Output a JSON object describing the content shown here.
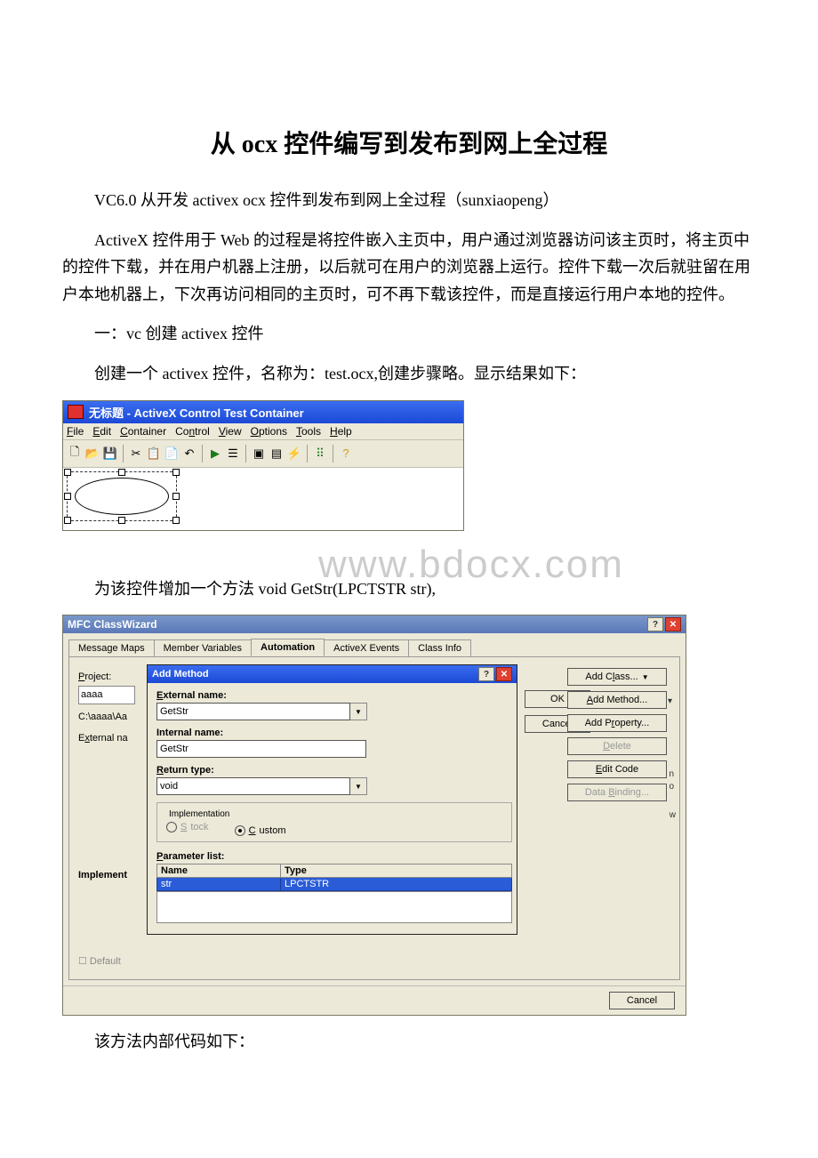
{
  "title": "从 ocx 控件编写到发布到网上全过程",
  "para1": "VC6.0 从开发 activex ocx 控件到发布到网上全过程（sunxiaopeng）",
  "para2": "ActiveX 控件用于 Web 的过程是将控件嵌入主页中，用户通过浏览器访问该主页时，将主页中的控件下载，并在用户机器上注册，以后就可在用户的浏览器上运行。控件下载一次后就驻留在用户本地机器上，下次再访问相同的主页时，可不再下载该控件，而是直接运行用户本地的控件。",
  "para3": "一：vc 创建 activex 控件",
  "para4": "创建一个 activex 控件，名称为：test.ocx,创建步骤略。显示结果如下：",
  "para5": "为该控件增加一个方法 void GetStr(LPCTSTR str),",
  "para6": "该方法内部代码如下：",
  "watermark": "www.bdocx.com",
  "shot1": {
    "title": "无标题 - ActiveX Control Test Container",
    "menu": {
      "file": "File",
      "edit": "Edit",
      "container": "Container",
      "control": "Control",
      "view": "View",
      "options": "Options",
      "tools": "Tools",
      "help": "Help"
    },
    "icons": {
      "new": "new-icon",
      "open": "open-icon",
      "save": "save-icon",
      "cut": "cut-icon",
      "copy": "copy-icon",
      "paste": "paste-icon",
      "undo": "undo-icon",
      "play": "play-icon",
      "prop": "prop-icon",
      "log1": "log1-icon",
      "log2": "log2-icon",
      "macro": "macro-icon",
      "grid": "grid-icon",
      "help": "help-icon"
    }
  },
  "shot2": {
    "title": "MFC ClassWizard",
    "tabs": {
      "t1": "Message Maps",
      "t2": "Member Variables",
      "t3": "Automation",
      "t4": "ActiveX Events",
      "t5": "Class Info"
    },
    "left": {
      "project_label": "Project:",
      "project_value": "aaaa",
      "path": "C:\\aaaa\\Aa",
      "extname_label": "External na",
      "implement_label": "Implement",
      "default_label": "Default"
    },
    "sidebuttons": {
      "addclass": "Add Class...",
      "addmethod": "Add Method...",
      "addprop": "Add Property...",
      "delete": "Delete",
      "editcode": "Edit Code",
      "databind": "Data Binding..."
    },
    "footer": {
      "cancel": "Cancel"
    },
    "peek": {
      "n": "n",
      "o": "o",
      "w": "w",
      "arrow": "▾"
    },
    "modal": {
      "title": "Add Method",
      "ok_label": "OK",
      "cancel_label": "Cancel",
      "external_name_label": "External name:",
      "external_name_value": "GetStr",
      "internal_name_label": "Internal name:",
      "internal_name_value": "GetStr",
      "return_type_label": "Return type:",
      "return_type_value": "void",
      "impl_group": "Implementation",
      "impl_stock": "Stock",
      "impl_custom": "Custom",
      "plist_label": "Parameter list:",
      "plist_cols": {
        "name": "Name",
        "type": "Type"
      },
      "plist_row": {
        "name": "str",
        "type": "LPCTSTR"
      }
    }
  }
}
